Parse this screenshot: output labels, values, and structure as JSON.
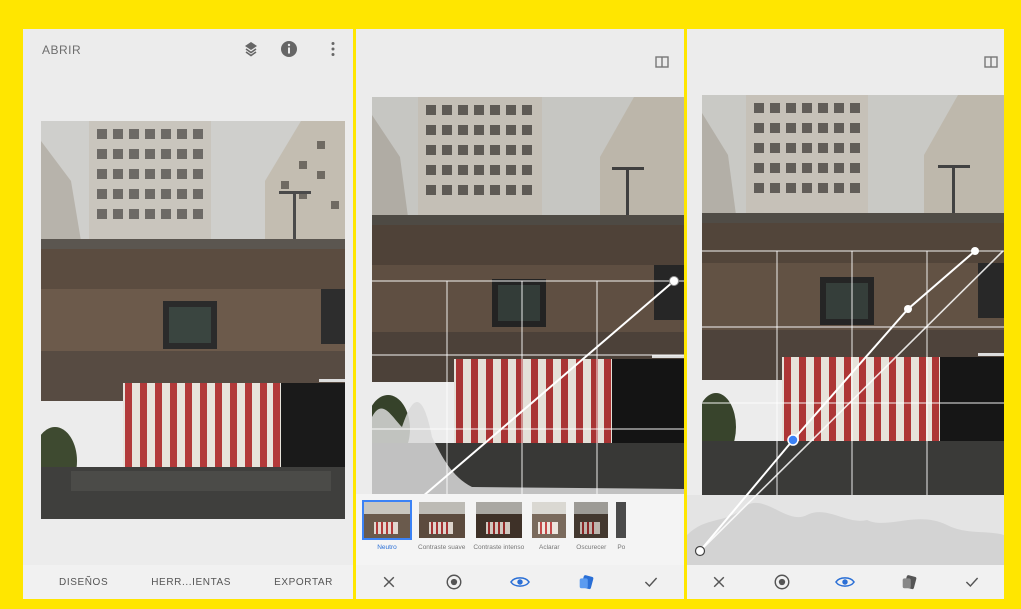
{
  "panel1": {
    "topbar": {
      "title": "ABRIR",
      "icons": [
        "layers-icon",
        "info-icon",
        "more-vert-icon"
      ]
    },
    "bottom_tabs": [
      "DISEÑOS",
      "HERR...IENTAS",
      "EXPORTAR"
    ]
  },
  "panel2": {
    "compare_icon": "compare-icon",
    "presets": [
      {
        "label": "Neutro",
        "selected": true
      },
      {
        "label": "Contraste suave",
        "selected": false
      },
      {
        "label": "Contraste intenso",
        "selected": false
      },
      {
        "label": "Aclarar",
        "selected": false
      },
      {
        "label": "Oscurecer",
        "selected": false
      },
      {
        "label": "Po",
        "selected": false
      }
    ],
    "actions": [
      "close-icon",
      "style-icon",
      "eye-icon",
      "curves-tool-icon",
      "check-icon"
    ]
  },
  "panel3": {
    "compare_icon": "compare-icon",
    "actions": [
      "close-icon",
      "style-icon",
      "eye-icon",
      "curves-tool-icon",
      "check-icon"
    ]
  },
  "colors": {
    "frame": "#ffe600",
    "panel_bg": "#ececec",
    "accent": "#3b82f6",
    "garage_red": "#b23a3a"
  }
}
